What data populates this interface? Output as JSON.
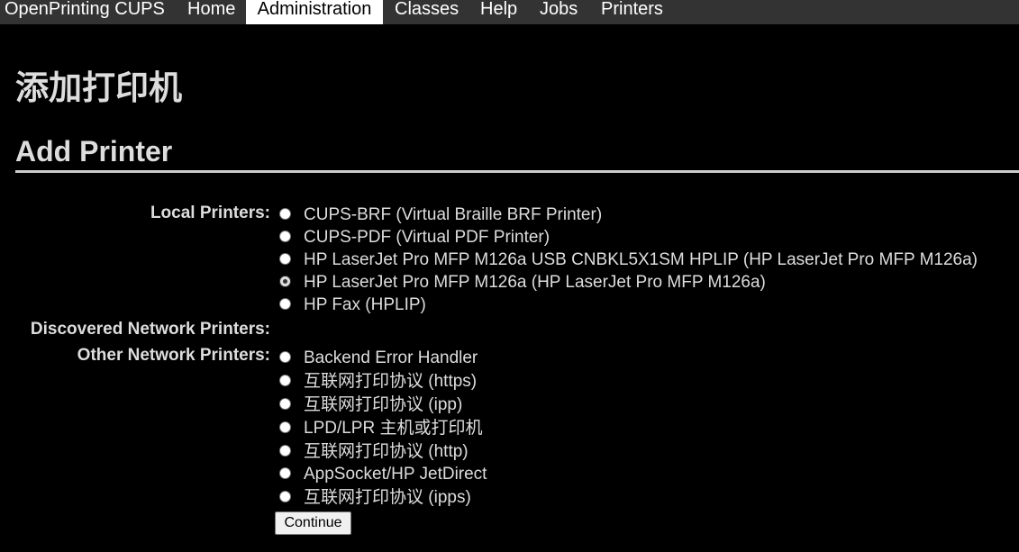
{
  "nav": {
    "items": [
      {
        "label": "OpenPrinting CUPS",
        "active": false
      },
      {
        "label": "Home",
        "active": false
      },
      {
        "label": "Administration",
        "active": true
      },
      {
        "label": "Classes",
        "active": false
      },
      {
        "label": "Help",
        "active": false
      },
      {
        "label": "Jobs",
        "active": false
      },
      {
        "label": "Printers",
        "active": false
      }
    ]
  },
  "page": {
    "title_cn": "添加打印机",
    "title_en": "Add Printer"
  },
  "form": {
    "local_label": "Local Printers:",
    "discovered_label": "Discovered Network Printers:",
    "other_label": "Other Network Printers:",
    "local_printers": [
      {
        "label": "CUPS-BRF (Virtual Braille BRF Printer)",
        "checked": false
      },
      {
        "label": "CUPS-PDF (Virtual PDF Printer)",
        "checked": false
      },
      {
        "label": "HP LaserJet Pro MFP M126a USB CNBKL5X1SM HPLIP (HP LaserJet Pro MFP M126a)",
        "checked": false
      },
      {
        "label": "HP LaserJet Pro MFP M126a (HP LaserJet Pro MFP M126a)",
        "checked": true
      },
      {
        "label": "HP Fax (HPLIP)",
        "checked": false
      }
    ],
    "other_printers": [
      {
        "label": "Backend Error Handler",
        "checked": false
      },
      {
        "label": "互联网打印协议 (https)",
        "checked": false
      },
      {
        "label": "互联网打印协议 (ipp)",
        "checked": false
      },
      {
        "label": "LPD/LPR 主机或打印机",
        "checked": false
      },
      {
        "label": "互联网打印协议 (http)",
        "checked": false
      },
      {
        "label": "AppSocket/HP JetDirect",
        "checked": false
      },
      {
        "label": "互联网打印协议 (ipps)",
        "checked": false
      }
    ],
    "continue_label": "Continue"
  },
  "colors": {
    "background": "#000000",
    "navbar": "#333333",
    "nav_active_bg": "#ffffff",
    "text": "#dddddd"
  }
}
